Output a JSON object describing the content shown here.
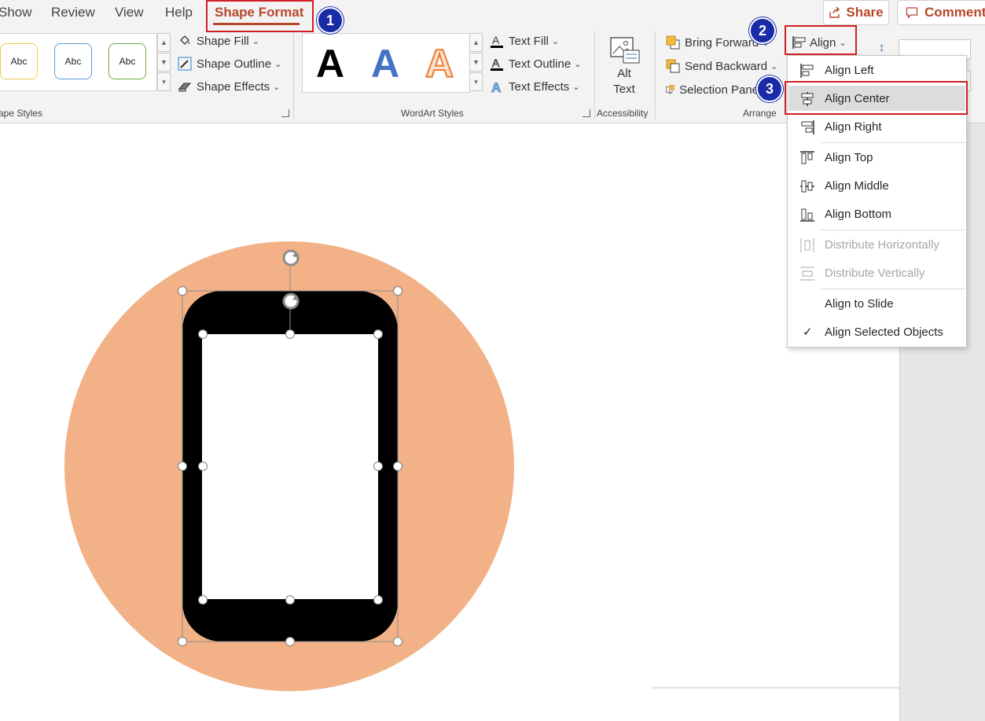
{
  "tabs": {
    "show": "Show",
    "review": "Review",
    "view": "View",
    "help": "Help",
    "shape_format": "Shape Format"
  },
  "top_buttons": {
    "share": "Share",
    "comments": "Comments"
  },
  "ribbon": {
    "shape_styles": {
      "label": "ape Styles",
      "swatches": [
        "Abc",
        "Abc",
        "Abc"
      ],
      "swatch_border_colors": [
        "#f2c94c",
        "#5b9bd5",
        "#70ad47"
      ],
      "commands": {
        "fill": "Shape Fill",
        "outline": "Shape Outline",
        "effects": "Shape Effects"
      }
    },
    "wordart_styles": {
      "label": "WordArt Styles",
      "samples": [
        "A",
        "A",
        "A"
      ],
      "sample_colors": [
        "#000000",
        "#4472c4",
        "#ed7d31"
      ],
      "commands": {
        "fill": "Text Fill",
        "outline": "Text Outline",
        "effects": "Text Effects"
      }
    },
    "accessibility": {
      "label": "Accessibility",
      "alt_text_line1": "Alt",
      "alt_text_line2": "Text"
    },
    "arrange": {
      "label": "Arrange",
      "bring_forward": "Bring Forward",
      "send_backward": "Send Backward",
      "selection_pane": "Selection Pane",
      "align": "Align"
    }
  },
  "align_menu": {
    "items": [
      {
        "label": "Align Left",
        "enabled": true
      },
      {
        "label": "Align Center",
        "enabled": true,
        "highlighted": true
      },
      {
        "label": "Align Right",
        "enabled": true
      },
      {
        "label": "Align Top",
        "enabled": true
      },
      {
        "label": "Align Middle",
        "enabled": true
      },
      {
        "label": "Align Bottom",
        "enabled": true
      },
      {
        "label": "Distribute Horizontally",
        "enabled": false
      },
      {
        "label": "Distribute Vertically",
        "enabled": false
      },
      {
        "label": "Align to Slide",
        "enabled": true
      },
      {
        "label": "Align Selected Objects",
        "enabled": true,
        "checked": true
      }
    ],
    "checkmark": "✓"
  },
  "annotations": {
    "step1": "1",
    "step2": "2",
    "step3": "3",
    "highlight_color": "#d21f26",
    "badge_color": "#1a2ba8"
  },
  "slide": {
    "circle_color": "#f2b186",
    "phone_color": "#000000",
    "screen_color": "#ffffff"
  },
  "icons": {
    "shape_fill": "paint-bucket-icon",
    "shape_outline": "pencil-icon",
    "shape_effects": "eraser-cube-icon",
    "text_fill": "text-fill-a-icon",
    "text_outline": "text-outline-a-icon",
    "text_effects": "text-effects-a-icon",
    "alt_text": "picture-text-icon",
    "bring_forward": "bring-forward-icon",
    "send_backward": "send-backward-icon",
    "selection_pane": "selection-pane-icon",
    "align": "align-icon",
    "rotate": "rotate-handle-icon",
    "share": "share-icon",
    "comments": "comment-icon"
  }
}
